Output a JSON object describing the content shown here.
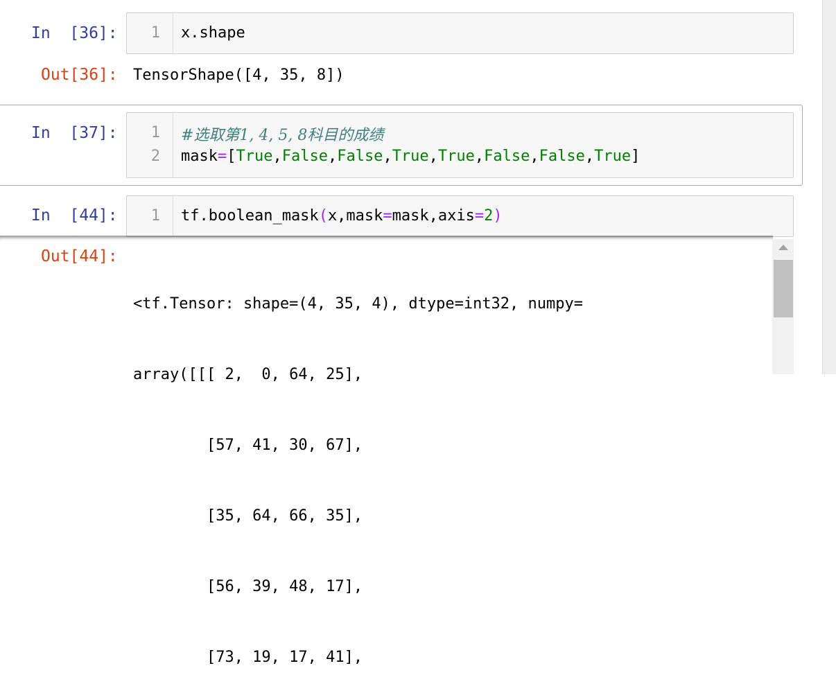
{
  "cells": [
    {
      "prompt_in": "In  [36]:",
      "lines": [
        {
          "num": "1",
          "code": "x.shape"
        }
      ],
      "prompt_out": "Out[36]:",
      "output": "TensorShape([4, 35, 8])"
    },
    {
      "prompt_in": "In  [37]:",
      "comment": "#选取第1, 4, 5, 8科目的成绩",
      "line_nums": [
        "1",
        "2"
      ],
      "mask_tokens": {
        "name": "mask",
        "eq": "=",
        "open": "[",
        "values": [
          "True",
          "False",
          "False",
          "True",
          "True",
          "False",
          "False",
          "True"
        ],
        "sep": ",",
        "close": "]"
      }
    },
    {
      "prompt_in": "In  [44]:",
      "line_num": "1",
      "code_parts": {
        "fn": "tf.boolean_mask",
        "open": "(",
        "arg1": "x,mask",
        "eq1": "=",
        "arg2": "mask,axis",
        "eq2": "=",
        "num": "2",
        "close": ")"
      },
      "prompt_out": "Out[44]:",
      "output_lines": [
        "<tf.Tensor: shape=(4, 35, 4), dtype=int32, numpy=",
        "array([[[ 2,  0, 64, 25],",
        "        [57, 41, 30, 67],",
        "        [35, 64, 66, 35],",
        "        [56, 39, 48, 17],",
        "        [73, 19, 17, 41],"
      ]
    }
  ]
}
